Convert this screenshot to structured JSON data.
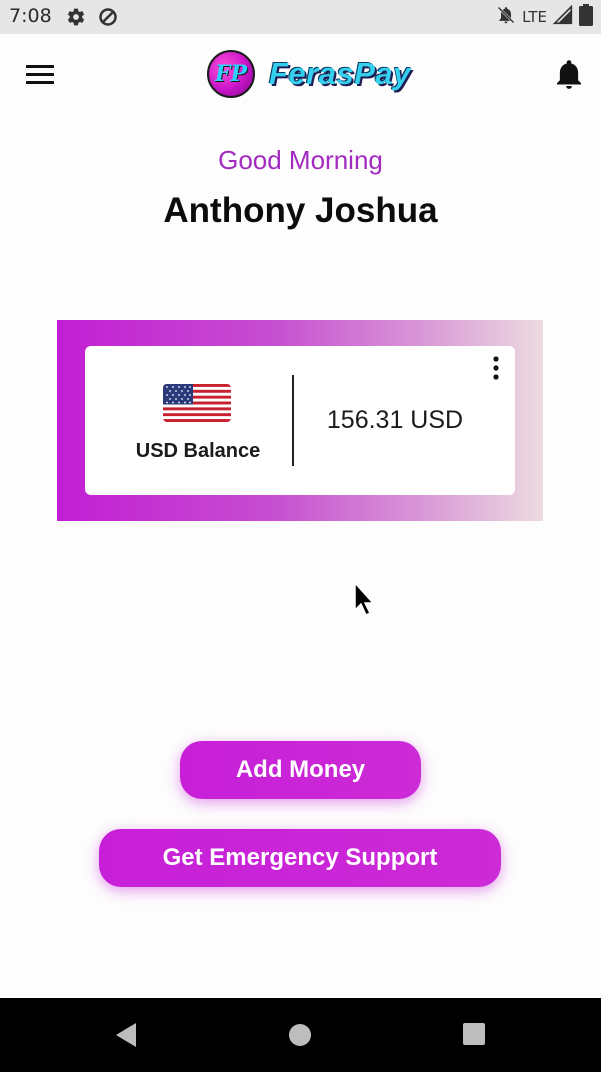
{
  "status_bar": {
    "time": "7:08",
    "network": "LTE",
    "icons": [
      "gear-icon",
      "vpn-icon",
      "notifications-off-icon",
      "signal-icon",
      "battery-icon"
    ]
  },
  "app_bar": {
    "logo_monogram": "FP",
    "brand_name": "FerasPay",
    "icons": [
      "menu-icon",
      "bell-icon"
    ]
  },
  "greeting": {
    "salutation": "Good Morning",
    "user_name": "Anthony Joshua"
  },
  "balance_card": {
    "flag_icon": "us-flag-icon",
    "label": "USD Balance",
    "amount": "156.31 USD",
    "menu_icon": "more-vert-icon"
  },
  "actions": {
    "add_money": "Add Money",
    "emergency_support": "Get Emergency Support"
  },
  "nav_bar": {
    "icons": [
      "back-icon",
      "home-icon",
      "recents-icon"
    ]
  },
  "colors": {
    "accent": "#c71fd8",
    "greeting": "#a32bc1",
    "brand_text": "#35d0ee"
  }
}
